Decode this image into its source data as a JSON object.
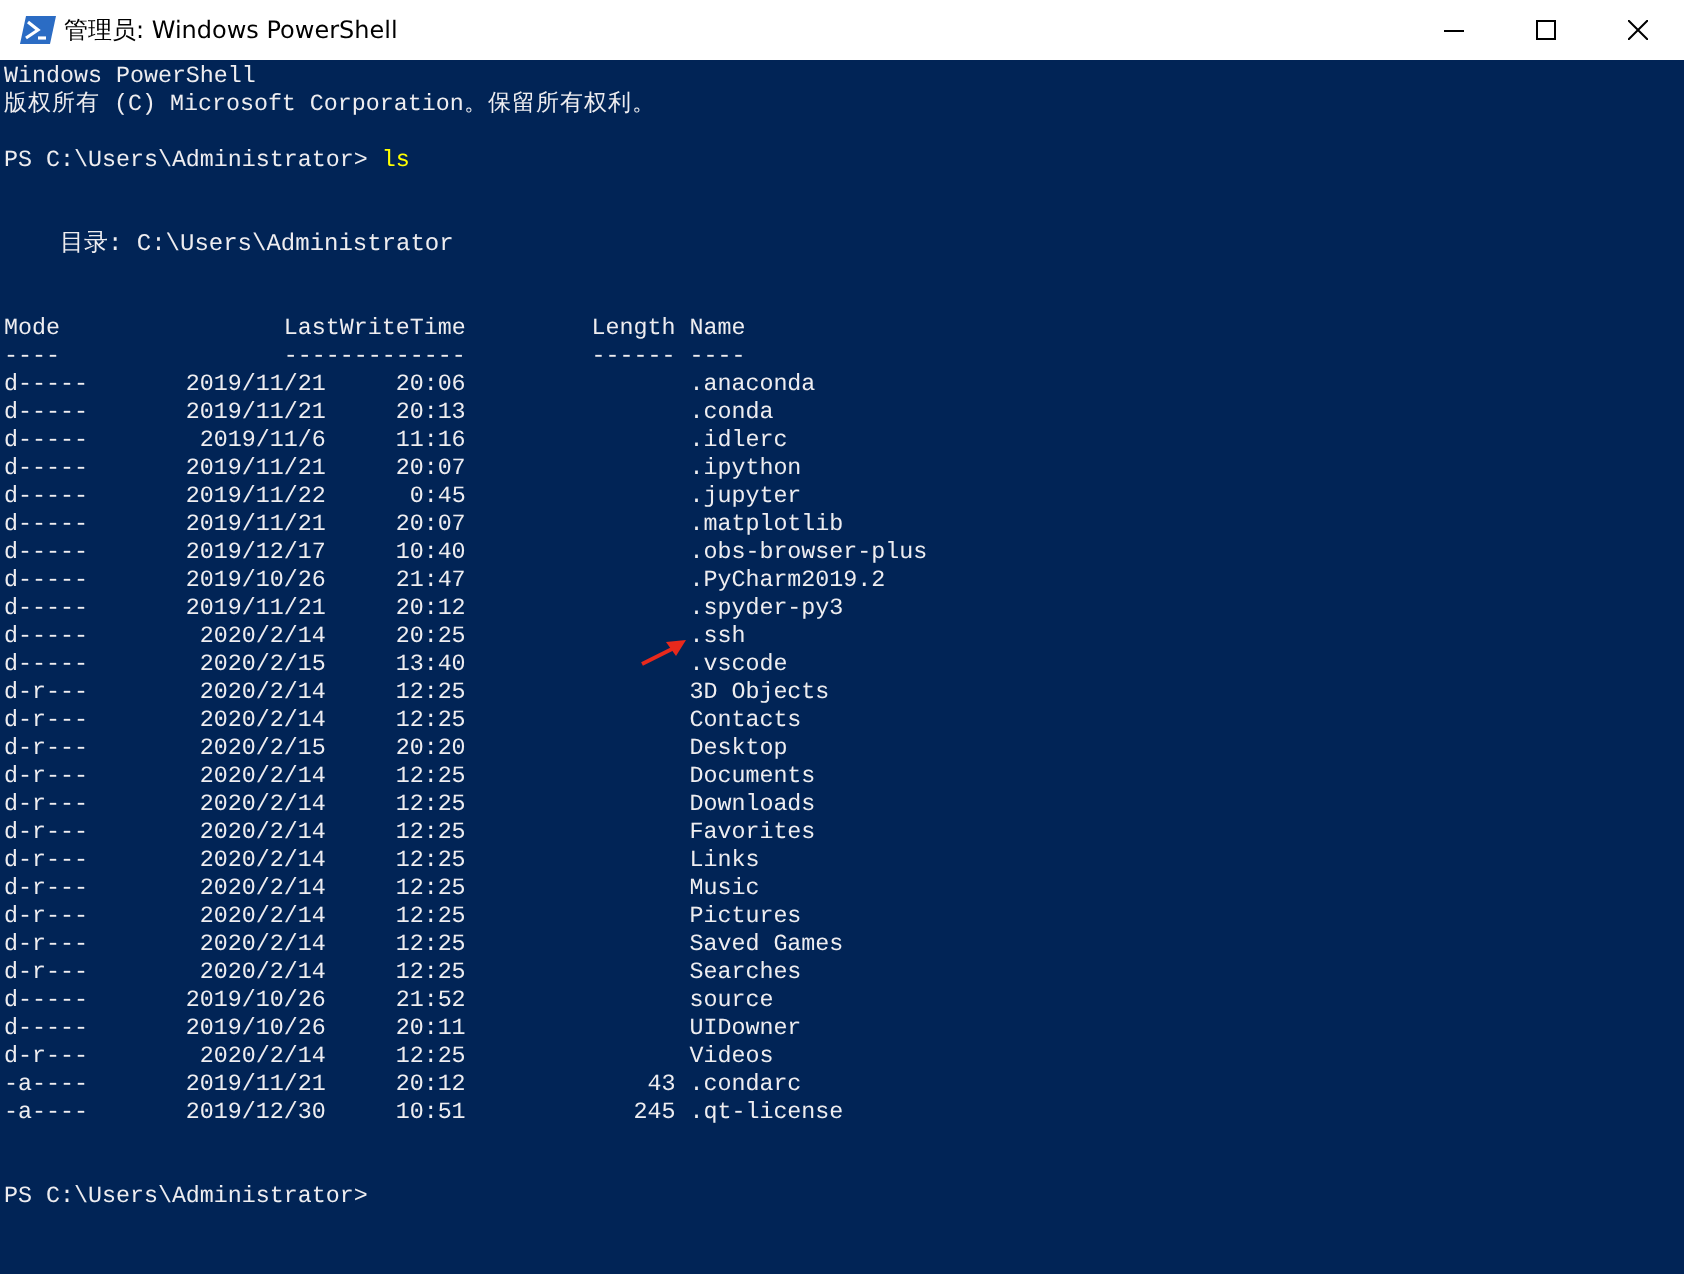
{
  "window": {
    "title": "管理员: Windows PowerShell"
  },
  "banner": [
    "Windows PowerShell",
    "版权所有 (C) Microsoft Corporation。保留所有权利。"
  ],
  "first_prompt": {
    "prompt": "PS C:\\Users\\Administrator>",
    "command": "ls"
  },
  "directory": "目录: C:\\Users\\Administrator",
  "columns": [
    {
      "label": "Mode",
      "underline": "----"
    },
    {
      "label": "LastWriteTime",
      "underline": "-------------"
    },
    {
      "label": "Length",
      "underline": "------"
    },
    {
      "label": "Name",
      "underline": "----"
    }
  ],
  "rows": [
    {
      "mode": "d-----",
      "date": "2019/11/21",
      "time": "20:06",
      "length": "",
      "name": ".anaconda"
    },
    {
      "mode": "d-----",
      "date": "2019/11/21",
      "time": "20:13",
      "length": "",
      "name": ".conda"
    },
    {
      "mode": "d-----",
      "date": "2019/11/6",
      "time": "11:16",
      "length": "",
      "name": ".idlerc"
    },
    {
      "mode": "d-----",
      "date": "2019/11/21",
      "time": "20:07",
      "length": "",
      "name": ".ipython"
    },
    {
      "mode": "d-----",
      "date": "2019/11/22",
      "time": "0:45",
      "length": "",
      "name": ".jupyter"
    },
    {
      "mode": "d-----",
      "date": "2019/11/21",
      "time": "20:07",
      "length": "",
      "name": ".matplotlib"
    },
    {
      "mode": "d-----",
      "date": "2019/12/17",
      "time": "10:40",
      "length": "",
      "name": ".obs-browser-plus"
    },
    {
      "mode": "d-----",
      "date": "2019/10/26",
      "time": "21:47",
      "length": "",
      "name": ".PyCharm2019.2"
    },
    {
      "mode": "d-----",
      "date": "2019/11/21",
      "time": "20:12",
      "length": "",
      "name": ".spyder-py3"
    },
    {
      "mode": "d-----",
      "date": "2020/2/14",
      "time": "20:25",
      "length": "",
      "name": ".ssh"
    },
    {
      "mode": "d-----",
      "date": "2020/2/15",
      "time": "13:40",
      "length": "",
      "name": ".vscode"
    },
    {
      "mode": "d-r---",
      "date": "2020/2/14",
      "time": "12:25",
      "length": "",
      "name": "3D Objects"
    },
    {
      "mode": "d-r---",
      "date": "2020/2/14",
      "time": "12:25",
      "length": "",
      "name": "Contacts"
    },
    {
      "mode": "d-r---",
      "date": "2020/2/15",
      "time": "20:20",
      "length": "",
      "name": "Desktop"
    },
    {
      "mode": "d-r---",
      "date": "2020/2/14",
      "time": "12:25",
      "length": "",
      "name": "Documents"
    },
    {
      "mode": "d-r---",
      "date": "2020/2/14",
      "time": "12:25",
      "length": "",
      "name": "Downloads"
    },
    {
      "mode": "d-r---",
      "date": "2020/2/14",
      "time": "12:25",
      "length": "",
      "name": "Favorites"
    },
    {
      "mode": "d-r---",
      "date": "2020/2/14",
      "time": "12:25",
      "length": "",
      "name": "Links"
    },
    {
      "mode": "d-r---",
      "date": "2020/2/14",
      "time": "12:25",
      "length": "",
      "name": "Music"
    },
    {
      "mode": "d-r---",
      "date": "2020/2/14",
      "time": "12:25",
      "length": "",
      "name": "Pictures"
    },
    {
      "mode": "d-r---",
      "date": "2020/2/14",
      "time": "12:25",
      "length": "",
      "name": "Saved Games"
    },
    {
      "mode": "d-r---",
      "date": "2020/2/14",
      "time": "12:25",
      "length": "",
      "name": "Searches"
    },
    {
      "mode": "d-----",
      "date": "2019/10/26",
      "time": "21:52",
      "length": "",
      "name": "source"
    },
    {
      "mode": "d-----",
      "date": "2019/10/26",
      "time": "20:11",
      "length": "",
      "name": "UIDowner"
    },
    {
      "mode": "d-r---",
      "date": "2020/2/14",
      "time": "12:25",
      "length": "",
      "name": "Videos"
    },
    {
      "mode": "-a----",
      "date": "2019/11/21",
      "time": "20:12",
      "length": "43",
      "name": ".condarc"
    },
    {
      "mode": "-a----",
      "date": "2019/12/30",
      "time": "10:51",
      "length": "245",
      "name": ".qt-license"
    }
  ],
  "last_prompt": {
    "prompt": "PS C:\\Users\\Administrator>"
  }
}
